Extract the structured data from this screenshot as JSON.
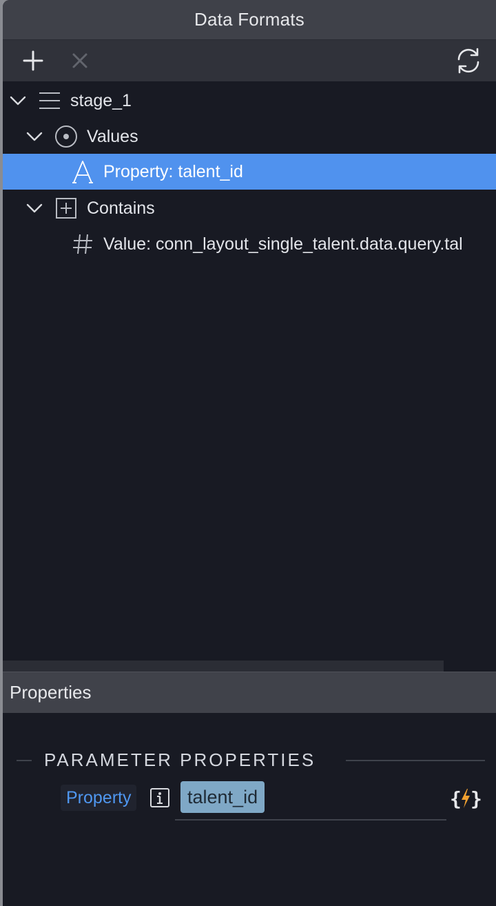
{
  "window": {
    "title": "Data Formats"
  },
  "toolbar": {
    "add": "add-icon",
    "delete": "close-icon",
    "refresh": "refresh-icon"
  },
  "tree": {
    "items": [
      {
        "label": "stage_1",
        "icon": "list-icon",
        "expanded": true
      },
      {
        "label": "Values",
        "icon": "target-icon",
        "expanded": true
      },
      {
        "label": "Property: talent_id",
        "icon": "text-type-icon",
        "selected": true
      },
      {
        "label": "Contains",
        "icon": "plus-box-icon",
        "expanded": true
      },
      {
        "label": "Value: conn_layout_single_talent.data.query.tal",
        "icon": "hash-icon"
      }
    ]
  },
  "properties": {
    "title": "Properties",
    "section_title": "PARAMETER PROPERTIES",
    "param": {
      "label": "Property",
      "value": "talent_id",
      "info_icon": "info-icon",
      "dynamic_icon": "dynamic-data-icon"
    }
  },
  "colors": {
    "panel_bg": "#181a23",
    "titlebar_bg": "#3f4149",
    "toolbar_bg": "#30323a",
    "selection": "#5092ee",
    "label_blue": "#4f97f0",
    "chip_bg": "#7fa8c6",
    "bolt": "#f0a030"
  }
}
